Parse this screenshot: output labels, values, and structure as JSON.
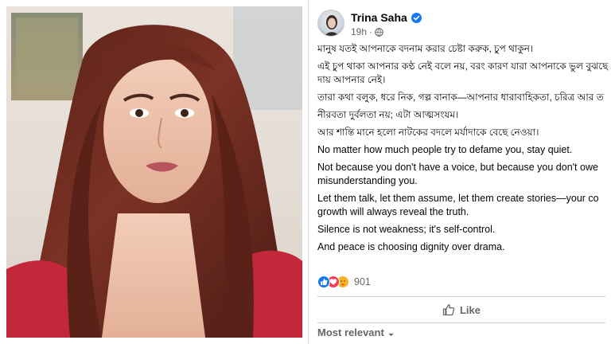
{
  "post": {
    "author": "Trina Saha",
    "timestamp": "19h",
    "verified_icon": "verified-badge-icon",
    "audience_icon": "globe-icon",
    "paragraphs": [
      {
        "lang": "bn",
        "lines": [
          "মানুষ যতই আপনাকে বদনাম করার চেষ্টা করুক, চুপ থাকুন।"
        ]
      },
      {
        "lang": "bn",
        "lines": [
          "এই চুপ থাকা আপনার কণ্ঠ নেই বলে নয়, বরং কারণ যারা আপনাকে ভুল বুঝছে",
          "দায় আপনার নেই।"
        ]
      },
      {
        "lang": "bn",
        "lines": [
          "তারা কথা বলুক, ধরে নিক, গল্প বানাক—আপনার ধারাবাহিকতা, চরিত্র আর ত"
        ]
      },
      {
        "lang": "bn",
        "lines": [
          "নীরবতা দুর্বলতা নয়; এটা আত্মসংযম।"
        ]
      },
      {
        "lang": "bn",
        "lines": [
          "আর শান্তি মানে হলো নাটকের বদলে মর্যাদাকে বেছে নেওয়া।"
        ]
      },
      {
        "lang": "en",
        "lines": [
          "No matter how much people try to defame you, stay quiet."
        ]
      },
      {
        "lang": "en",
        "lines": [
          "Not because you don't have a voice, but because you don't owe",
          "misunderstanding you."
        ]
      },
      {
        "lang": "en",
        "lines": [
          "Let them talk, let them assume, let them create stories—your co",
          "growth will always reveal the truth."
        ]
      },
      {
        "lang": "en",
        "lines": [
          "Silence is not weakness; it's self-control."
        ]
      },
      {
        "lang": "en",
        "lines": [
          "And peace is choosing dignity over drama."
        ]
      }
    ],
    "reactions": {
      "icons": [
        "like-icon",
        "love-icon",
        "care-icon"
      ],
      "count": "901"
    },
    "actions": {
      "like_label": "Like"
    },
    "comments_sort": {
      "label": "Most relevant"
    },
    "colors": {
      "like_blue": "#1877f2",
      "love_red": "#f33e58",
      "care_yellow": "#f7b125",
      "meta_gray": "#65676b"
    }
  }
}
